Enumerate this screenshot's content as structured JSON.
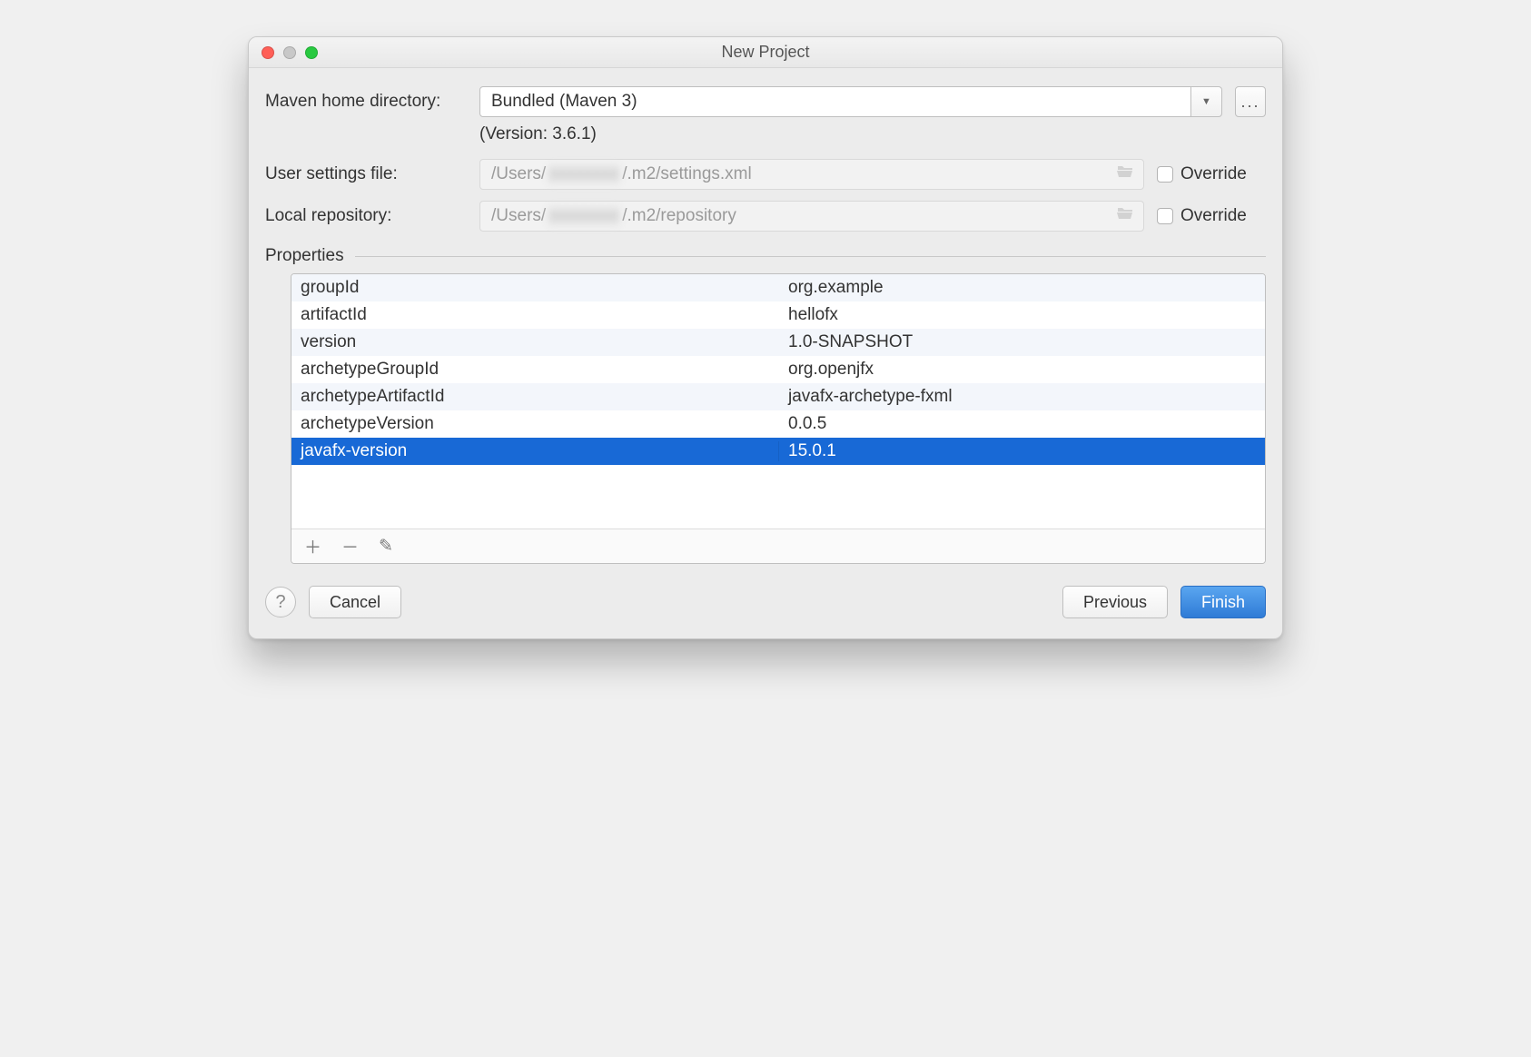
{
  "window": {
    "title": "New Project"
  },
  "labels": {
    "maven_home": "Maven home directory:",
    "user_settings": "User settings file:",
    "local_repo": "Local repository:",
    "properties": "Properties",
    "override": "Override"
  },
  "maven": {
    "home_value": "Bundled (Maven 3)",
    "version_note": "(Version: 3.6.1)",
    "more_glyph": "..."
  },
  "paths": {
    "settings_prefix": "/Users/",
    "settings_blur": "xxxxxxxx",
    "settings_suffix": "/.m2/settings.xml",
    "repo_prefix": "/Users/",
    "repo_blur": "xxxxxxxx",
    "repo_suffix": "/.m2/repository"
  },
  "properties": [
    {
      "key": "groupId",
      "value": "org.example"
    },
    {
      "key": "artifactId",
      "value": "hellofx"
    },
    {
      "key": "version",
      "value": "1.0-SNAPSHOT"
    },
    {
      "key": "archetypeGroupId",
      "value": "org.openjfx"
    },
    {
      "key": "archetypeArtifactId",
      "value": "javafx-archetype-fxml"
    },
    {
      "key": "archetypeVersion",
      "value": "0.0.5"
    },
    {
      "key": "javafx-version",
      "value": "15.0.1",
      "selected": true
    }
  ],
  "buttons": {
    "help": "?",
    "cancel": "Cancel",
    "previous": "Previous",
    "finish": "Finish"
  },
  "icons": {
    "chevron_down": "▼",
    "plus": "＋",
    "minus": "－",
    "pencil": "✎"
  }
}
